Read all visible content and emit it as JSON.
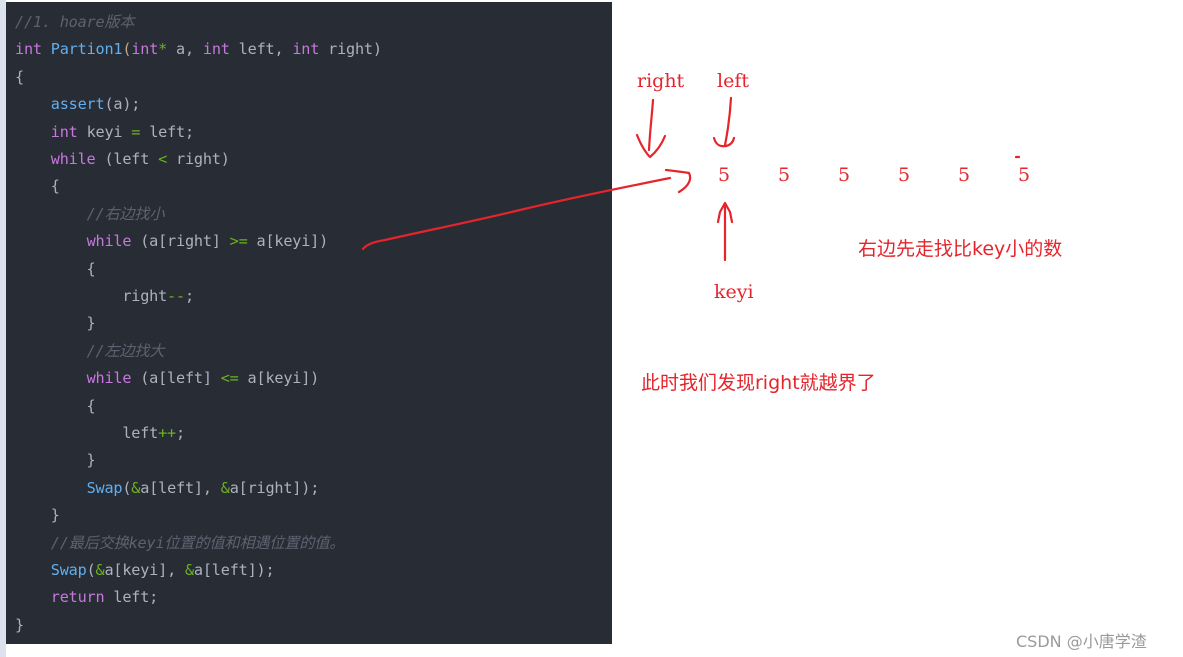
{
  "code": {
    "language": "c",
    "lines": [
      [
        {
          "t": "//1. hoare版本",
          "c": "cm"
        }
      ],
      [
        {
          "t": "int",
          "c": "kw"
        },
        {
          "t": " "
        },
        {
          "t": "Partion1",
          "c": "fn"
        },
        {
          "t": "(",
          "c": "pn"
        },
        {
          "t": "int",
          "c": "kw"
        },
        {
          "t": "*",
          "c": "op"
        },
        {
          "t": " a, "
        },
        {
          "t": "int",
          "c": "kw"
        },
        {
          "t": " left, "
        },
        {
          "t": "int",
          "c": "kw"
        },
        {
          "t": " right)"
        }
      ],
      [
        {
          "t": "{"
        }
      ],
      [
        {
          "t": "    "
        },
        {
          "t": "assert",
          "c": "fn"
        },
        {
          "t": "(a);"
        }
      ],
      [
        {
          "t": "    "
        },
        {
          "t": "int",
          "c": "kw"
        },
        {
          "t": " keyi "
        },
        {
          "t": "=",
          "c": "op"
        },
        {
          "t": " left;"
        }
      ],
      [
        {
          "t": "    "
        },
        {
          "t": "while",
          "c": "kw"
        },
        {
          "t": " (left "
        },
        {
          "t": "<",
          "c": "op"
        },
        {
          "t": " right)"
        }
      ],
      [
        {
          "t": "    {"
        }
      ],
      [
        {
          "t": "        "
        },
        {
          "t": "//右边找小",
          "c": "cm"
        }
      ],
      [
        {
          "t": "        "
        },
        {
          "t": "while",
          "c": "kw"
        },
        {
          "t": " (a[right] "
        },
        {
          "t": ">=",
          "c": "op"
        },
        {
          "t": " a[keyi])"
        }
      ],
      [
        {
          "t": "        {"
        }
      ],
      [
        {
          "t": "            right"
        },
        {
          "t": "--",
          "c": "op"
        },
        {
          "t": ";"
        }
      ],
      [
        {
          "t": "        }"
        }
      ],
      [
        {
          "t": "        "
        },
        {
          "t": "//左边找大",
          "c": "cm"
        }
      ],
      [
        {
          "t": "        "
        },
        {
          "t": "while",
          "c": "kw"
        },
        {
          "t": " (a[left] "
        },
        {
          "t": "<=",
          "c": "op"
        },
        {
          "t": " a[keyi])"
        }
      ],
      [
        {
          "t": "        {"
        }
      ],
      [
        {
          "t": "            left"
        },
        {
          "t": "++",
          "c": "op"
        },
        {
          "t": ";"
        }
      ],
      [
        {
          "t": "        }"
        }
      ],
      [
        {
          "t": "        "
        },
        {
          "t": "Swap",
          "c": "fn"
        },
        {
          "t": "("
        },
        {
          "t": "&",
          "c": "op"
        },
        {
          "t": "a[left], "
        },
        {
          "t": "&",
          "c": "op"
        },
        {
          "t": "a[right]);"
        }
      ],
      [
        {
          "t": "    }"
        }
      ],
      [
        {
          "t": "    "
        },
        {
          "t": "//最后交换keyi位置的值和相遇位置的值。",
          "c": "cm"
        }
      ],
      [
        {
          "t": "    "
        },
        {
          "t": "Swap",
          "c": "fn"
        },
        {
          "t": "("
        },
        {
          "t": "&",
          "c": "op"
        },
        {
          "t": "a[keyi], "
        },
        {
          "t": "&",
          "c": "op"
        },
        {
          "t": "a[left]);"
        }
      ],
      [
        {
          "t": "    "
        },
        {
          "t": "return",
          "c": "kw"
        },
        {
          "t": " left;"
        }
      ],
      [
        {
          "t": "}"
        }
      ]
    ]
  },
  "annotations": {
    "pointer_right_label": "right",
    "pointer_left_label": "left",
    "pointer_keyi_label": "keyi",
    "array_values": [
      "5",
      "5",
      "5",
      "5",
      "5",
      "5"
    ],
    "note_1": "右边先走找比key小的数",
    "note_2": "此时我们发现right就越界了",
    "accent_color": "#e5242b"
  },
  "watermark": "CSDN @小唐学渣"
}
